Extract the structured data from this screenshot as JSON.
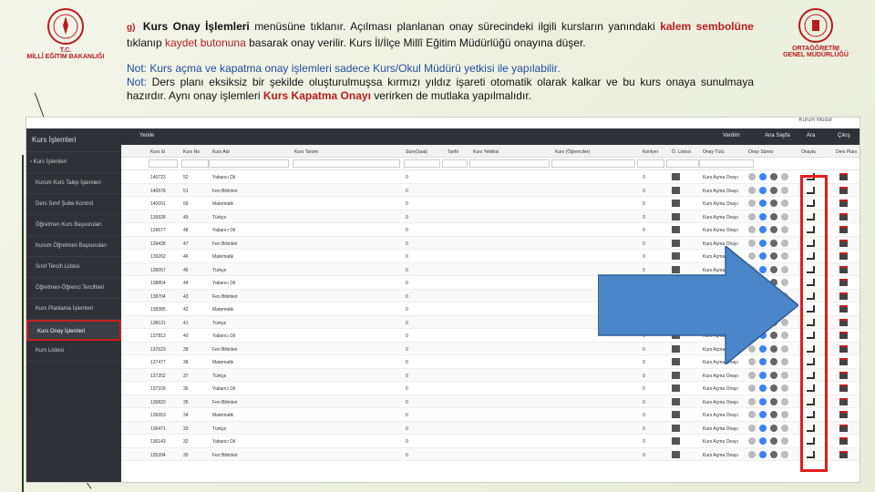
{
  "logos": {
    "left": {
      "line1": "T.C.",
      "line2": "MİLLÎ EĞİTİM BAKANLIĞI"
    },
    "right": {
      "line1": "ORTAÖĞRETİM",
      "line2": "GENEL MÜDÜRLÜĞÜ"
    }
  },
  "text": {
    "lead": "g)",
    "p1_a": "Kurs Onay İşlemleri",
    "p1_b": " menüsüne tıklanır. Açılması planlanan onay sürecindeki ilgili kursların yanındaki ",
    "p1_c": "kalem sembolüne",
    "p1_d": " tıklanıp ",
    "p1_e": "kaydet butonuna",
    "p1_f": " basarak onay verilir. Kurs İl/İlçe Millî Eğitim Müdürlüğü onayına düşer.",
    "p2_line1": "Not: Kurs açma ve kapatma onay işlemleri sadece Kurs/Okul Müdürü yetkisi ile yapılabilir.",
    "p2_note": "Not:",
    "p2_b": " Ders planı eksiksiz bir şekilde oluşturulmuşsa kırmızı yıldız işareti otomatik olarak kalkar ve bu kurs onaya sunulmaya hazırdır. Aynı onay işlemleri ",
    "p2_c": "Kurs Kapatma Onayı",
    "p2_d": " verirken de mutlaka yapılmalıdır."
  },
  "app": {
    "user": "Kurum Müdür",
    "sidebar_title": "Kurs İşlemleri",
    "sidebar": [
      "› Kurs İşlemleri",
      "Kurum Kurs Talep İşlemleri",
      "Ders Sınıf Şube Kontrol",
      "Öğretmen Kurs Başvuruları",
      "Kurum Öğretmen Başvuruları",
      "Sınıf Tercih Listesi",
      "Öğretmen-Öğrenci Tercihleri",
      "Kurs Planlama İşlemleri",
      "Kurs Onay İşlemleri",
      "Kurs Listesi"
    ],
    "toolbar": {
      "left": "Yenile",
      "r1": "Verdim",
      "r2": "Ana Sayfa",
      "r3": "Ara",
      "r4": "Çıkış"
    },
    "columns": [
      "Kurs Id",
      "Kurs No",
      "Kurs Adı",
      "Kurs Tanımı",
      "Süre(Saat)",
      "Tarihi",
      "Kurs Yetkilisi",
      "Kurs (Öğrenciler)",
      "Kontyer",
      "Ö. Listesi",
      "Onay Türü",
      "Onay Süreci",
      "Onayla",
      "Ders Planı"
    ],
    "rows": [
      [
        "140723",
        "52",
        "Yabancı Dil"
      ],
      [
        "140578",
        "51",
        "Fen Bilimleri"
      ],
      [
        "140091",
        "50",
        "Matematik"
      ],
      [
        "139928",
        "49",
        "Türkçe"
      ],
      [
        "139677",
        "48",
        "Yabancı Dil"
      ],
      [
        "139438",
        "47",
        "Fen Bilimleri"
      ],
      [
        "139262",
        "46",
        "Matematik"
      ],
      [
        "139057",
        "45",
        "Türkçe"
      ],
      [
        "138854",
        "44",
        "Yabancı Dil"
      ],
      [
        "138704",
        "43",
        "Fen Bilimleri"
      ],
      [
        "138385",
        "42",
        "Matematik"
      ],
      [
        "138121",
        "41",
        "Türkçe"
      ],
      [
        "137813",
        "40",
        "Yabancı Dil"
      ],
      [
        "137623",
        "39",
        "Fen Bilimleri"
      ],
      [
        "137477",
        "38",
        "Matematik"
      ],
      [
        "137252",
        "37",
        "Türkçe"
      ],
      [
        "137109",
        "36",
        "Yabancı Dil"
      ],
      [
        "136820",
        "35",
        "Fen Bilimleri"
      ],
      [
        "136653",
        "34",
        "Matematik"
      ],
      [
        "136471",
        "33",
        "Türkçe"
      ],
      [
        "136143",
        "32",
        "Yabancı Dil"
      ],
      [
        "135394",
        "30",
        "Fen Bilimleri"
      ]
    ],
    "row_time": "0",
    "row_count": "0",
    "row_type": "Kurs Açma Onayı"
  }
}
